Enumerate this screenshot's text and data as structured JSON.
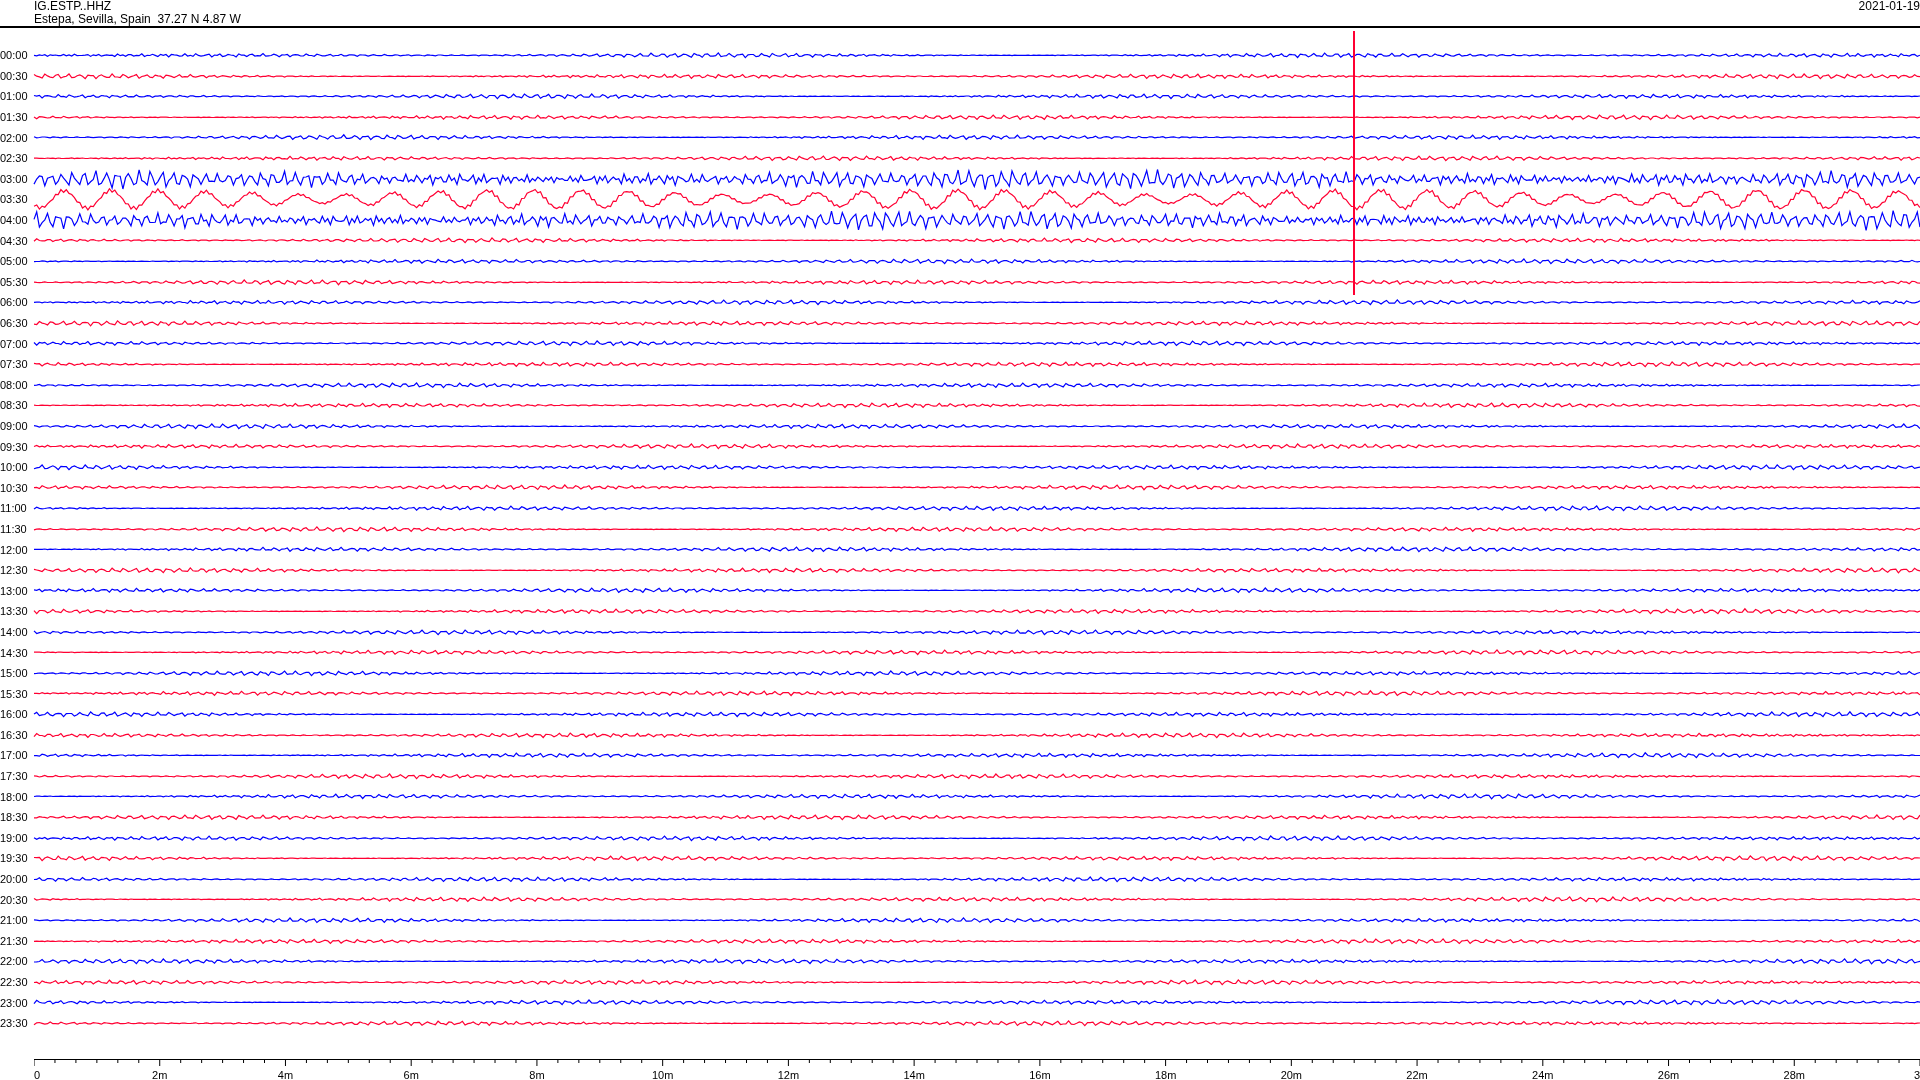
{
  "header": {
    "station": "IG.ESTP..HHZ",
    "location": "Estepa, Sevilla, Spain  37.27 N 4.87 W",
    "date": "2021-01-19"
  },
  "rows": [
    {
      "time": "00:00",
      "color": "#0000ff",
      "kind": "quiet"
    },
    {
      "time": "00:30",
      "color": "#ff0033",
      "kind": "quiet"
    },
    {
      "time": "01:00",
      "color": "#0000ff",
      "kind": "quiet"
    },
    {
      "time": "01:30",
      "color": "#ff0033",
      "kind": "quiet"
    },
    {
      "time": "02:00",
      "color": "#0000ff",
      "kind": "quiet"
    },
    {
      "time": "02:30",
      "color": "#ff0033",
      "kind": "quiet"
    },
    {
      "time": "03:00",
      "color": "#0000ff",
      "kind": "active"
    },
    {
      "time": "03:30",
      "color": "#ff0033",
      "kind": "swell"
    },
    {
      "time": "04:00",
      "color": "#0000ff",
      "kind": "active"
    },
    {
      "time": "04:30",
      "color": "#ff0033",
      "kind": "quiet"
    },
    {
      "time": "05:00",
      "color": "#0000ff",
      "kind": "quiet"
    },
    {
      "time": "05:30",
      "color": "#ff0033",
      "kind": "quiet"
    },
    {
      "time": "06:00",
      "color": "#0000ff",
      "kind": "quiet"
    },
    {
      "time": "06:30",
      "color": "#ff0033",
      "kind": "quiet"
    },
    {
      "time": "07:00",
      "color": "#0000ff",
      "kind": "quiet"
    },
    {
      "time": "07:30",
      "color": "#ff0033",
      "kind": "quiet"
    },
    {
      "time": "08:00",
      "color": "#0000ff",
      "kind": "quiet"
    },
    {
      "time": "08:30",
      "color": "#ff0033",
      "kind": "quiet"
    },
    {
      "time": "09:00",
      "color": "#0000ff",
      "kind": "quiet"
    },
    {
      "time": "09:30",
      "color": "#ff0033",
      "kind": "quiet"
    },
    {
      "time": "10:00",
      "color": "#0000ff",
      "kind": "quiet"
    },
    {
      "time": "10:30",
      "color": "#ff0033",
      "kind": "quiet"
    },
    {
      "time": "11:00",
      "color": "#0000ff",
      "kind": "quiet"
    },
    {
      "time": "11:30",
      "color": "#ff0033",
      "kind": "quiet"
    },
    {
      "time": "12:00",
      "color": "#0000ff",
      "kind": "quiet"
    },
    {
      "time": "12:30",
      "color": "#ff0033",
      "kind": "quiet"
    },
    {
      "time": "13:00",
      "color": "#0000ff",
      "kind": "quiet"
    },
    {
      "time": "13:30",
      "color": "#ff0033",
      "kind": "quiet"
    },
    {
      "time": "14:00",
      "color": "#0000ff",
      "kind": "quiet"
    },
    {
      "time": "14:30",
      "color": "#ff0033",
      "kind": "quiet"
    },
    {
      "time": "15:00",
      "color": "#0000ff",
      "kind": "quiet"
    },
    {
      "time": "15:30",
      "color": "#ff0033",
      "kind": "quiet"
    },
    {
      "time": "16:00",
      "color": "#0000ff",
      "kind": "quiet"
    },
    {
      "time": "16:30",
      "color": "#ff0033",
      "kind": "quiet"
    },
    {
      "time": "17:00",
      "color": "#0000ff",
      "kind": "quiet"
    },
    {
      "time": "17:30",
      "color": "#ff0033",
      "kind": "quiet"
    },
    {
      "time": "18:00",
      "color": "#0000ff",
      "kind": "quiet"
    },
    {
      "time": "18:30",
      "color": "#ff0033",
      "kind": "quiet"
    },
    {
      "time": "19:00",
      "color": "#0000ff",
      "kind": "quiet"
    },
    {
      "time": "19:30",
      "color": "#ff0033",
      "kind": "quiet"
    },
    {
      "time": "20:00",
      "color": "#0000ff",
      "kind": "quiet"
    },
    {
      "time": "20:30",
      "color": "#ff0033",
      "kind": "quiet"
    },
    {
      "time": "21:00",
      "color": "#0000ff",
      "kind": "quiet"
    },
    {
      "time": "21:30",
      "color": "#ff0033",
      "kind": "quiet"
    },
    {
      "time": "22:00",
      "color": "#0000ff",
      "kind": "quiet"
    },
    {
      "time": "22:30",
      "color": "#ff0033",
      "kind": "quiet"
    },
    {
      "time": "23:00",
      "color": "#0000ff",
      "kind": "quiet"
    },
    {
      "time": "23:30",
      "color": "#ff0033",
      "kind": "quiet"
    }
  ],
  "axis": {
    "labels": [
      "0",
      "2m",
      "4m",
      "6m",
      "8m",
      "10m",
      "12m",
      "14m",
      "16m",
      "18m",
      "20m",
      "22m",
      "24m",
      "26m",
      "28m",
      "3"
    ]
  }
}
